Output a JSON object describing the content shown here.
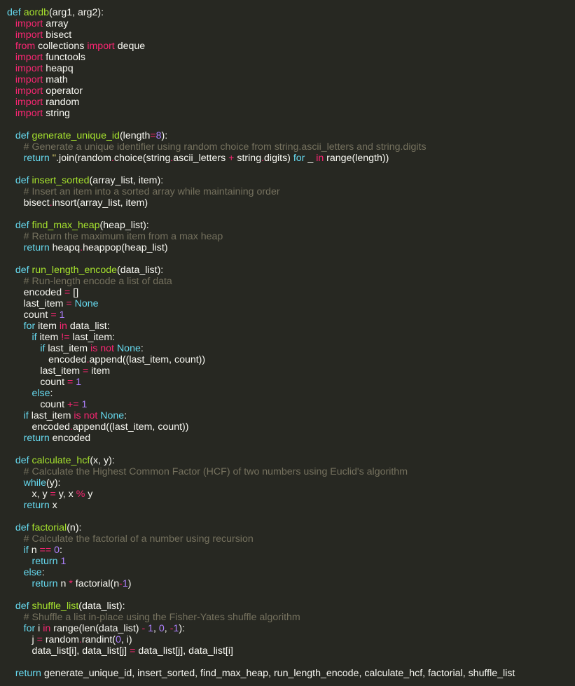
{
  "editor": {
    "indent_unit": "   ",
    "colors": {
      "background": "#272822",
      "text": "#f8f8f2",
      "keyword": "#66d9ef",
      "import_keyword": "#f92672",
      "function_name": "#a6e22e",
      "number": "#ae81ff",
      "operator": "#f92672",
      "comment": "#75715e",
      "string": "#e6db74"
    },
    "lines": [
      {
        "indent": 0,
        "tokens": [
          [
            "kw",
            "def"
          ],
          [
            "tx",
            " "
          ],
          [
            "fn",
            "aordb"
          ],
          [
            "tx",
            "(arg1, arg2):"
          ]
        ]
      },
      {
        "indent": 1,
        "tokens": [
          [
            "imp",
            "import"
          ],
          [
            "tx",
            " array"
          ]
        ]
      },
      {
        "indent": 1,
        "tokens": [
          [
            "imp",
            "import"
          ],
          [
            "tx",
            " bisect"
          ]
        ]
      },
      {
        "indent": 1,
        "tokens": [
          [
            "imp",
            "from"
          ],
          [
            "tx",
            " collections "
          ],
          [
            "imp",
            "import"
          ],
          [
            "tx",
            " deque"
          ]
        ]
      },
      {
        "indent": 1,
        "tokens": [
          [
            "imp",
            "import"
          ],
          [
            "tx",
            " functools"
          ]
        ]
      },
      {
        "indent": 1,
        "tokens": [
          [
            "imp",
            "import"
          ],
          [
            "tx",
            " heapq"
          ]
        ]
      },
      {
        "indent": 1,
        "tokens": [
          [
            "imp",
            "import"
          ],
          [
            "tx",
            " math"
          ]
        ]
      },
      {
        "indent": 1,
        "tokens": [
          [
            "imp",
            "import"
          ],
          [
            "tx",
            " operator"
          ]
        ]
      },
      {
        "indent": 1,
        "tokens": [
          [
            "imp",
            "import"
          ],
          [
            "tx",
            " random"
          ]
        ]
      },
      {
        "indent": 1,
        "tokens": [
          [
            "imp",
            "import"
          ],
          [
            "tx",
            " string"
          ]
        ]
      },
      {
        "indent": 0,
        "tokens": []
      },
      {
        "indent": 1,
        "tokens": [
          [
            "kw",
            "def"
          ],
          [
            "tx",
            " "
          ],
          [
            "fn",
            "generate_unique_id"
          ],
          [
            "tx",
            "(length"
          ],
          [
            "op",
            "="
          ],
          [
            "num",
            "8"
          ],
          [
            "tx",
            "):"
          ]
        ]
      },
      {
        "indent": 2,
        "tokens": [
          [
            "cm",
            "# Generate a unique identifier using random choice from string.ascii_letters and string.digits"
          ]
        ]
      },
      {
        "indent": 2,
        "tokens": [
          [
            "kw",
            "return"
          ],
          [
            "tx",
            " "
          ],
          [
            "st",
            "''"
          ],
          [
            "tx",
            ".join(random"
          ],
          [
            "op",
            "."
          ],
          [
            "tx",
            "choice(string"
          ],
          [
            "op",
            "."
          ],
          [
            "tx",
            "ascii_letters "
          ],
          [
            "op",
            "+"
          ],
          [
            "tx",
            " string"
          ],
          [
            "op",
            "."
          ],
          [
            "tx",
            "digits) "
          ],
          [
            "kw",
            "for"
          ],
          [
            "tx",
            " _ "
          ],
          [
            "op",
            "in"
          ],
          [
            "tx",
            " range(length))"
          ]
        ]
      },
      {
        "indent": 0,
        "tokens": []
      },
      {
        "indent": 1,
        "tokens": [
          [
            "kw",
            "def"
          ],
          [
            "tx",
            " "
          ],
          [
            "fn",
            "insert_sorted"
          ],
          [
            "tx",
            "(array_list, item):"
          ]
        ]
      },
      {
        "indent": 2,
        "tokens": [
          [
            "cm",
            "# Insert an item into a sorted array while maintaining order"
          ]
        ]
      },
      {
        "indent": 2,
        "tokens": [
          [
            "tx",
            "bisect"
          ],
          [
            "op",
            "."
          ],
          [
            "tx",
            "insort(array_list, item)"
          ]
        ]
      },
      {
        "indent": 0,
        "tokens": []
      },
      {
        "indent": 1,
        "tokens": [
          [
            "kw",
            "def"
          ],
          [
            "tx",
            " "
          ],
          [
            "fn",
            "find_max_heap"
          ],
          [
            "tx",
            "(heap_list):"
          ]
        ]
      },
      {
        "indent": 2,
        "tokens": [
          [
            "cm",
            "# Return the maximum item from a max heap"
          ]
        ]
      },
      {
        "indent": 2,
        "tokens": [
          [
            "kw",
            "return"
          ],
          [
            "tx",
            " heapq"
          ],
          [
            "op",
            "."
          ],
          [
            "tx",
            "heappop(heap_list)"
          ]
        ]
      },
      {
        "indent": 0,
        "tokens": []
      },
      {
        "indent": 1,
        "tokens": [
          [
            "kw",
            "def"
          ],
          [
            "tx",
            " "
          ],
          [
            "fn",
            "run_length_encode"
          ],
          [
            "tx",
            "(data_list):"
          ]
        ]
      },
      {
        "indent": 2,
        "tokens": [
          [
            "cm",
            "# Run-length encode a list of data"
          ]
        ]
      },
      {
        "indent": 2,
        "tokens": [
          [
            "tx",
            "encoded "
          ],
          [
            "op",
            "="
          ],
          [
            "tx",
            " []"
          ]
        ]
      },
      {
        "indent": 2,
        "tokens": [
          [
            "tx",
            "last_item "
          ],
          [
            "op",
            "="
          ],
          [
            "tx",
            " "
          ],
          [
            "kw",
            "None"
          ]
        ]
      },
      {
        "indent": 2,
        "tokens": [
          [
            "tx",
            "count "
          ],
          [
            "op",
            "="
          ],
          [
            "tx",
            " "
          ],
          [
            "num",
            "1"
          ]
        ]
      },
      {
        "indent": 2,
        "tokens": [
          [
            "kw",
            "for"
          ],
          [
            "tx",
            " item "
          ],
          [
            "op",
            "in"
          ],
          [
            "tx",
            " data_list:"
          ]
        ]
      },
      {
        "indent": 3,
        "tokens": [
          [
            "kw",
            "if"
          ],
          [
            "tx",
            " item "
          ],
          [
            "op",
            "!="
          ],
          [
            "tx",
            " last_item:"
          ]
        ]
      },
      {
        "indent": 4,
        "tokens": [
          [
            "kw",
            "if"
          ],
          [
            "tx",
            " last_item "
          ],
          [
            "op",
            "is not"
          ],
          [
            "tx",
            " "
          ],
          [
            "kw",
            "None"
          ],
          [
            "tx",
            ":"
          ]
        ]
      },
      {
        "indent": 5,
        "tokens": [
          [
            "tx",
            "encoded"
          ],
          [
            "op",
            "."
          ],
          [
            "tx",
            "append((last_item, count))"
          ]
        ]
      },
      {
        "indent": 4,
        "tokens": [
          [
            "tx",
            "last_item "
          ],
          [
            "op",
            "="
          ],
          [
            "tx",
            " item"
          ]
        ]
      },
      {
        "indent": 4,
        "tokens": [
          [
            "tx",
            "count "
          ],
          [
            "op",
            "="
          ],
          [
            "tx",
            " "
          ],
          [
            "num",
            "1"
          ]
        ]
      },
      {
        "indent": 3,
        "tokens": [
          [
            "kw",
            "else"
          ],
          [
            "tx",
            ":"
          ]
        ]
      },
      {
        "indent": 4,
        "tokens": [
          [
            "tx",
            "count "
          ],
          [
            "op",
            "+="
          ],
          [
            "tx",
            " "
          ],
          [
            "num",
            "1"
          ]
        ]
      },
      {
        "indent": 2,
        "tokens": [
          [
            "kw",
            "if"
          ],
          [
            "tx",
            " last_item "
          ],
          [
            "op",
            "is not"
          ],
          [
            "tx",
            " "
          ],
          [
            "kw",
            "None"
          ],
          [
            "tx",
            ":"
          ]
        ]
      },
      {
        "indent": 3,
        "tokens": [
          [
            "tx",
            "encoded"
          ],
          [
            "op",
            "."
          ],
          [
            "tx",
            "append((last_item, count))"
          ]
        ]
      },
      {
        "indent": 2,
        "tokens": [
          [
            "kw",
            "return"
          ],
          [
            "tx",
            " encoded"
          ]
        ]
      },
      {
        "indent": 0,
        "tokens": []
      },
      {
        "indent": 1,
        "tokens": [
          [
            "kw",
            "def"
          ],
          [
            "tx",
            " "
          ],
          [
            "fn",
            "calculate_hcf"
          ],
          [
            "tx",
            "(x, y):"
          ]
        ]
      },
      {
        "indent": 2,
        "tokens": [
          [
            "cm",
            "# Calculate the Highest Common Factor (HCF) of two numbers using Euclid's algorithm"
          ]
        ]
      },
      {
        "indent": 2,
        "tokens": [
          [
            "kw",
            "while"
          ],
          [
            "tx",
            "(y):"
          ]
        ]
      },
      {
        "indent": 3,
        "tokens": [
          [
            "tx",
            "x, y "
          ],
          [
            "op",
            "="
          ],
          [
            "tx",
            " y, x "
          ],
          [
            "op",
            "%"
          ],
          [
            "tx",
            " y"
          ]
        ]
      },
      {
        "indent": 2,
        "tokens": [
          [
            "kw",
            "return"
          ],
          [
            "tx",
            " x"
          ]
        ]
      },
      {
        "indent": 0,
        "tokens": []
      },
      {
        "indent": 1,
        "tokens": [
          [
            "kw",
            "def"
          ],
          [
            "tx",
            " "
          ],
          [
            "fn",
            "factorial"
          ],
          [
            "tx",
            "(n):"
          ]
        ]
      },
      {
        "indent": 2,
        "tokens": [
          [
            "cm",
            "# Calculate the factorial of a number using recursion"
          ]
        ]
      },
      {
        "indent": 2,
        "tokens": [
          [
            "kw",
            "if"
          ],
          [
            "tx",
            " n "
          ],
          [
            "op",
            "=="
          ],
          [
            "tx",
            " "
          ],
          [
            "num",
            "0"
          ],
          [
            "tx",
            ":"
          ]
        ]
      },
      {
        "indent": 3,
        "tokens": [
          [
            "kw",
            "return"
          ],
          [
            "tx",
            " "
          ],
          [
            "num",
            "1"
          ]
        ]
      },
      {
        "indent": 2,
        "tokens": [
          [
            "kw",
            "else"
          ],
          [
            "tx",
            ":"
          ]
        ]
      },
      {
        "indent": 3,
        "tokens": [
          [
            "kw",
            "return"
          ],
          [
            "tx",
            " n "
          ],
          [
            "op",
            "*"
          ],
          [
            "tx",
            " factorial(n"
          ],
          [
            "op",
            "-"
          ],
          [
            "num",
            "1"
          ],
          [
            "tx",
            ")"
          ]
        ]
      },
      {
        "indent": 0,
        "tokens": []
      },
      {
        "indent": 1,
        "tokens": [
          [
            "kw",
            "def"
          ],
          [
            "tx",
            " "
          ],
          [
            "fn",
            "shuffle_list"
          ],
          [
            "tx",
            "(data_list):"
          ]
        ]
      },
      {
        "indent": 2,
        "tokens": [
          [
            "cm",
            "# Shuffle a list in-place using the Fisher-Yates shuffle algorithm"
          ]
        ]
      },
      {
        "indent": 2,
        "tokens": [
          [
            "kw",
            "for"
          ],
          [
            "tx",
            " i "
          ],
          [
            "op",
            "in"
          ],
          [
            "tx",
            " range(len(data_list) "
          ],
          [
            "op",
            "-"
          ],
          [
            "tx",
            " "
          ],
          [
            "num",
            "1"
          ],
          [
            "tx",
            ", "
          ],
          [
            "num",
            "0"
          ],
          [
            "tx",
            ", "
          ],
          [
            "op",
            "-"
          ],
          [
            "num",
            "1"
          ],
          [
            "tx",
            "):"
          ]
        ]
      },
      {
        "indent": 3,
        "tokens": [
          [
            "tx",
            "j "
          ],
          [
            "op",
            "="
          ],
          [
            "tx",
            " random"
          ],
          [
            "op",
            "."
          ],
          [
            "tx",
            "randint("
          ],
          [
            "num",
            "0"
          ],
          [
            "tx",
            ", i)"
          ]
        ]
      },
      {
        "indent": 3,
        "tokens": [
          [
            "tx",
            "data_list[i], data_list[j] "
          ],
          [
            "op",
            "="
          ],
          [
            "tx",
            " data_list[j], data_list[i]"
          ]
        ]
      },
      {
        "indent": 0,
        "tokens": []
      },
      {
        "indent": 1,
        "tokens": [
          [
            "kw",
            "return"
          ],
          [
            "tx",
            " generate_unique_id, insert_sorted, find_max_heap, run_length_encode, calculate_hcf, factorial, shuffle_list"
          ]
        ]
      }
    ]
  }
}
